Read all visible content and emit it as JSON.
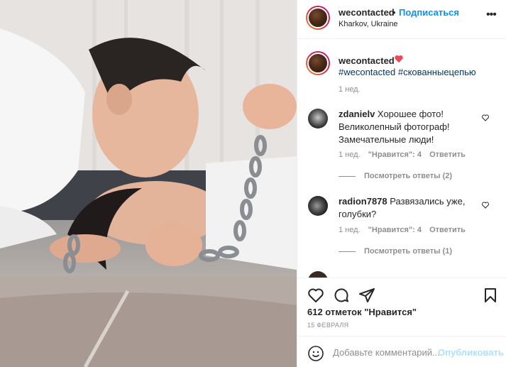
{
  "post": {
    "username": "wecontacted",
    "follow_label": "Подписаться",
    "separator": "•",
    "location": "Kharkov, Ukraine",
    "more_label": "•••"
  },
  "caption": {
    "username": "wecontacted",
    "hashtags": "#wecontacted #скованныецепью",
    "time": "1 нед."
  },
  "comments": [
    {
      "username": "zdanielv",
      "text": "Хорошее фото! Великолепный фотограф! Замечательные люди!",
      "time": "1 нед.",
      "likes": "\"Нравится\": 4",
      "reply": "Ответить",
      "view_replies": "Посмотреть ответы (2)"
    },
    {
      "username": "radion7878",
      "text": "Развязались уже, голубки?",
      "time": "1 нед.",
      "likes": "\"Нравится\": 4",
      "reply": "Ответить",
      "view_replies": "Посмотреть ответы (1)"
    }
  ],
  "stats": {
    "likes_text": "612 отметок \"Нравится\"",
    "date": "15 ФЕВРАЛЯ"
  },
  "composer": {
    "placeholder": "Добавьте комментарий...",
    "publish_label": "Опубликовать"
  },
  "icons": {
    "like": "heart-icon",
    "comment": "comment-icon",
    "share": "paper-plane-icon",
    "save": "bookmark-icon",
    "emoji": "smiley-icon"
  },
  "colors": {
    "link_blue": "#0095f6",
    "hashtag_blue": "#00376b",
    "heart_red": "#ed4956",
    "publish_disabled": "#b2dffc"
  }
}
